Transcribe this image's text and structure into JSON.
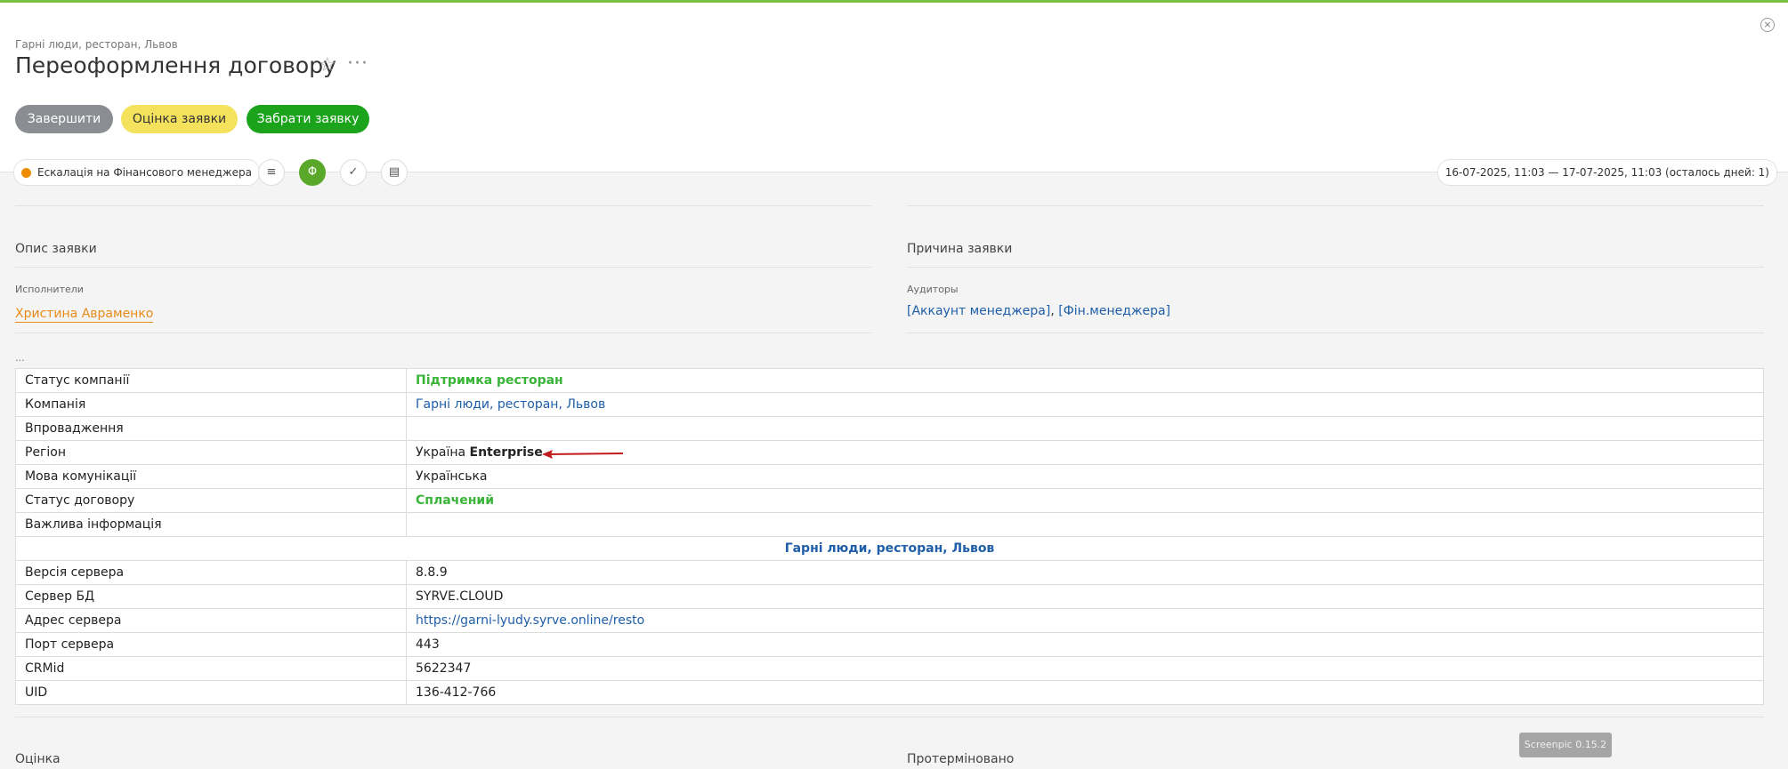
{
  "header": {
    "breadcrumb": "Гарні люди, ресторан, Львов",
    "title": "Переоформлення договору",
    "star_icon": "☆",
    "more_icon": "···",
    "close_icon": "×"
  },
  "actions": {
    "complete": "Завершити",
    "rate": "Оцінка заявки",
    "take": "Забрати заявку"
  },
  "toolbar": {
    "status": "Ескалація на Фінансового менеджера",
    "dates": "16-07-2025, 11:03 — 17-07-2025, 11:03  (осталось дней: 1)",
    "icons": [
      "list-icon",
      "phi-icon",
      "check-circle-icon",
      "comment-icon"
    ]
  },
  "left": {
    "description_title": "Опис заявки",
    "executors_label": "Исполнители",
    "executor": "Христина Авраменко",
    "dots": "..."
  },
  "right": {
    "reason_title": "Причина заявки",
    "auditors_label": "Аудиторы",
    "auditor_1": "[Аккаунт менеджера]",
    "separator": ",",
    "auditor_2": "[Фін.менеджера]"
  },
  "table": {
    "rows": [
      {
        "k": "Статус компанії",
        "v": "Підтримка ресторан"
      },
      {
        "k": "Компанія",
        "v": "Гарні люди, ресторан, Львов"
      },
      {
        "k": "Впровадження",
        "v": ""
      },
      {
        "k": "Регіон",
        "v": "Україна",
        "v_bold": "Enterprise"
      },
      {
        "k": "Мова комунікації",
        "v": "Українська"
      },
      {
        "k": "Статус договору",
        "v": "Сплачений"
      },
      {
        "k": "Важлива інформація",
        "v": ""
      },
      {
        "section": "Гарні люди, ресторан, Львов"
      },
      {
        "k": "Версія сервера",
        "v": "8.8.9"
      },
      {
        "k": "Сервер БД",
        "v": "SYRVE.CLOUD"
      },
      {
        "k": "Адрес сервера",
        "v": "https://garni-lyudy.syrve.online/resto"
      },
      {
        "k": "Порт сервера",
        "v": "443"
      },
      {
        "k": "CRMid",
        "v": "5622347"
      },
      {
        "k": "UID",
        "v": "136-412-766"
      }
    ]
  },
  "bottom": {
    "rating_title": "Оцінка",
    "expired_title": "Протерміновано"
  },
  "watermark": "Screenpic 0.15.2",
  "colors": {
    "accent_green": "#1ba31b",
    "status_orange": "#f08c00",
    "link_blue": "#1f5ea8"
  }
}
